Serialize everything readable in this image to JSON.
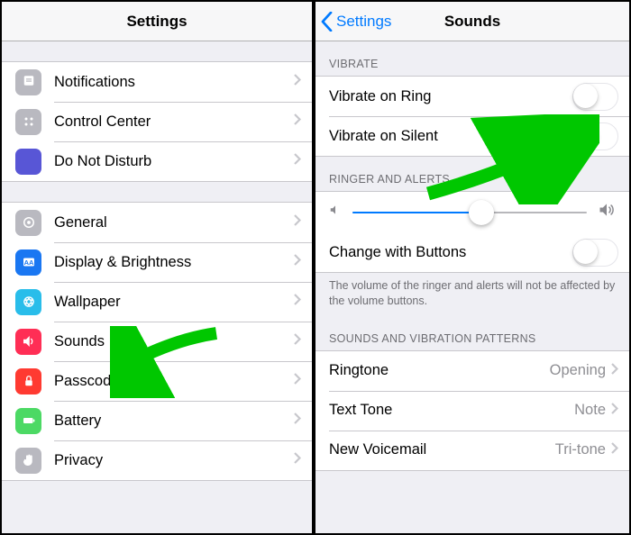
{
  "left": {
    "title": "Settings",
    "group1": [
      {
        "key": "notifications",
        "label": "Notifications",
        "iconBg": "#b9b9c0",
        "icon": "notifications"
      },
      {
        "key": "control-center",
        "label": "Control Center",
        "iconBg": "#b9b9c0",
        "icon": "control-center"
      },
      {
        "key": "dnd",
        "label": "Do Not Disturb",
        "iconBg": "#5856d6",
        "icon": "moon"
      }
    ],
    "group2": [
      {
        "key": "general",
        "label": "General",
        "iconBg": "#b9b9c0",
        "icon": "gear"
      },
      {
        "key": "display",
        "label": "Display & Brightness",
        "iconBg": "#1a77f2",
        "icon": "display"
      },
      {
        "key": "wallpaper",
        "label": "Wallpaper",
        "iconBg": "#29bdea",
        "icon": "wallpaper"
      },
      {
        "key": "sounds",
        "label": "Sounds",
        "iconBg": "#ff2e55",
        "icon": "sounds"
      },
      {
        "key": "passcode",
        "label": "Passcode",
        "iconBg": "#ff3a31",
        "icon": "lock"
      },
      {
        "key": "battery",
        "label": "Battery",
        "iconBg": "#4cd964",
        "icon": "battery"
      },
      {
        "key": "privacy",
        "label": "Privacy",
        "iconBg": "#b9b9c0",
        "icon": "hand"
      }
    ]
  },
  "right": {
    "back": "Settings",
    "title": "Sounds",
    "vibrate_header": "VIBRATE",
    "vibrate_items": [
      {
        "key": "vibrate-ring",
        "label": "Vibrate on Ring",
        "on": false
      },
      {
        "key": "vibrate-silent",
        "label": "Vibrate on Silent",
        "on": false
      }
    ],
    "ringer_header": "RINGER AND ALERTS",
    "volume_percent": 55,
    "change_buttons_label": "Change with Buttons",
    "change_buttons_on": false,
    "ringer_footer": "The volume of the ringer and alerts will not be affected by the volume buttons.",
    "patterns_header": "SOUNDS AND VIBRATION PATTERNS",
    "patterns": [
      {
        "key": "ringtone",
        "label": "Ringtone",
        "value": "Opening"
      },
      {
        "key": "texttone",
        "label": "Text Tone",
        "value": "Note"
      },
      {
        "key": "voicemail",
        "label": "New Voicemail",
        "value": "Tri-tone"
      }
    ]
  }
}
